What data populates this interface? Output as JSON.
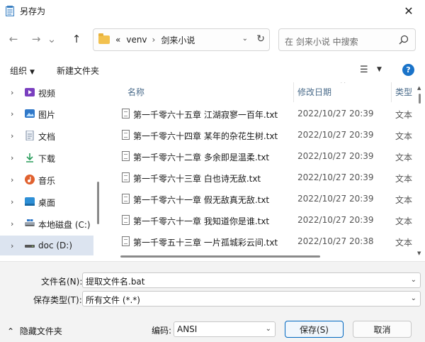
{
  "window": {
    "title": "另存为",
    "close_glyph": "✕"
  },
  "nav": {
    "back_glyph": "←",
    "forward_glyph": "→",
    "recent_glyph": "⌄",
    "up_glyph": "↑",
    "breadcrumb": [
      "«",
      "venv",
      "›",
      "剑来小说"
    ],
    "address_chevron": "⌄",
    "refresh_glyph": "↻",
    "search_placeholder": "在 剑来小说 中搜索"
  },
  "toolbar": {
    "organize_label": "组织",
    "organize_chevron": "▼",
    "new_folder_label": "新建文件夹",
    "view_glyph": "☰",
    "view_chevron": "▼",
    "help_glyph": "?"
  },
  "sidebar": {
    "items": [
      {
        "label": "视频",
        "chevron": "›",
        "icon": "video-icon",
        "color": "#7a3fbf"
      },
      {
        "label": "图片",
        "chevron": "›",
        "icon": "pictures-icon",
        "color": "#2f78c9"
      },
      {
        "label": "文档",
        "chevron": "›",
        "icon": "documents-icon",
        "color": "#7a8aa0"
      },
      {
        "label": "下载",
        "chevron": "›",
        "icon": "download-icon",
        "color": "#2a9d5c"
      },
      {
        "label": "音乐",
        "chevron": "›",
        "icon": "music-icon",
        "color": "#e0612f"
      },
      {
        "label": "桌面",
        "chevron": "›",
        "icon": "desktop-icon",
        "color": "#2d8fd6"
      },
      {
        "label": "本地磁盘 (C:)",
        "chevron": "›",
        "icon": "drive-icon",
        "color": "#555555"
      },
      {
        "label": "doc (D:)",
        "chevron": "›",
        "icon": "drive-icon",
        "color": "#444444"
      }
    ],
    "selected_index": 7
  },
  "filelist": {
    "columns": {
      "name": "名称",
      "date": "修改日期",
      "type": "类型"
    },
    "sort_glyph": "^",
    "rows": [
      {
        "name": "第一千零六十五章  江湖寂寥一百年.txt",
        "date": "2022/10/27 20:39",
        "type": "文本"
      },
      {
        "name": "第一千零六十四章  某年的杂花生树.txt",
        "date": "2022/10/27 20:39",
        "type": "文本"
      },
      {
        "name": "第一千零六十二章  多余即是温柔.txt",
        "date": "2022/10/27 20:39",
        "type": "文本"
      },
      {
        "name": "第一千零六十三章  白也诗无敌.txt",
        "date": "2022/10/27 20:39",
        "type": "文本"
      },
      {
        "name": "第一千零六十一章  假无敌真无敌.txt",
        "date": "2022/10/27 20:39",
        "type": "文本"
      },
      {
        "name": "第一千零六十一章 我知道你是谁.txt",
        "date": "2022/10/27 20:39",
        "type": "文本"
      },
      {
        "name": "第一千零五十三章    一片孤城彩云间.txt",
        "date": "2022/10/27 20:38",
        "type": "文本"
      }
    ]
  },
  "form": {
    "filename_label": "文件名(N):",
    "filename_value": "提取文件名.bat",
    "filetype_label": "保存类型(T):",
    "filetype_value": "所有文件  (*.*)",
    "encoding_label": "编码:",
    "encoding_value": "ANSI",
    "combo_chevron": "⌄",
    "hide_folders_glyph": "⌃",
    "hide_folders_label": "隐藏文件夹",
    "save_label": "保存(S)",
    "cancel_label": "取消"
  }
}
